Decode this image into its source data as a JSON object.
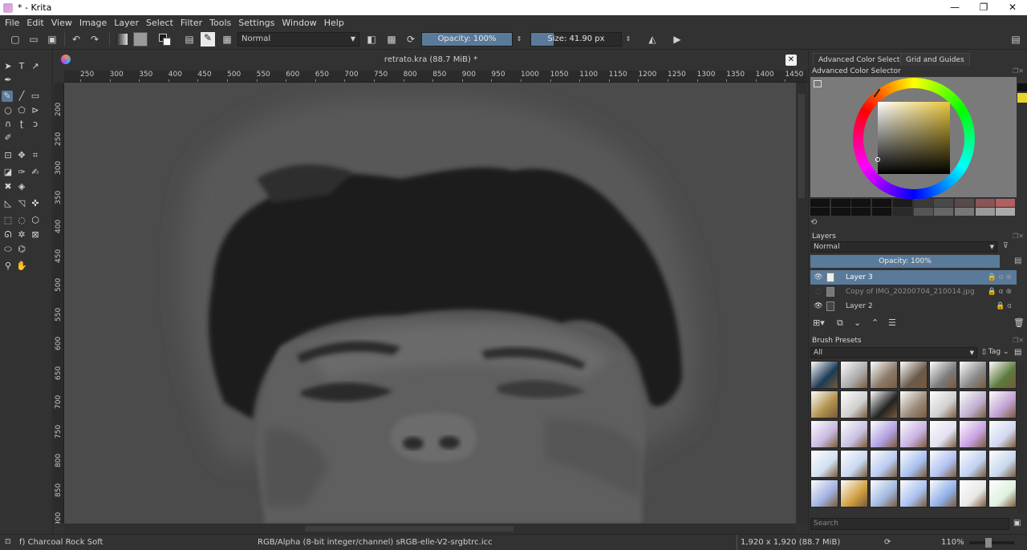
{
  "window": {
    "title": "* - Krita",
    "controls": [
      "—",
      "❐",
      "✕"
    ]
  },
  "menu": [
    "File",
    "Edit",
    "View",
    "Image",
    "Layer",
    "Select",
    "Filter",
    "Tools",
    "Settings",
    "Window",
    "Help"
  ],
  "toolbar": {
    "blend_mode": "Normal",
    "opacity_label": "Opacity: 100%",
    "opacity_value": 1.0,
    "size_label": "Size: 41.90 px",
    "size_fill": 0.25
  },
  "document": {
    "tab_title": "retrato.kra (88.7 MiB) *",
    "h_ruler": [
      "250",
      "300",
      "350",
      "400",
      "450",
      "500",
      "550",
      "600",
      "650",
      "700",
      "750",
      "800",
      "850",
      "900",
      "950",
      "1000",
      "1050",
      "1100",
      "1150",
      "1200",
      "1250",
      "1300",
      "1350",
      "1400",
      "1450"
    ],
    "v_ruler": [
      "200",
      "250",
      "300",
      "350",
      "400",
      "450",
      "500",
      "550",
      "600",
      "650",
      "700",
      "750",
      "800",
      "850",
      "900"
    ]
  },
  "panels": {
    "tabs": [
      "Advanced Color Selector",
      "Grid and Guides"
    ],
    "color_selector_title": "Advanced Color Selector",
    "selected_color": "#e8c63a",
    "layers": {
      "title": "Layers",
      "blend_mode": "Normal",
      "opacity_label": "Opacity:  100%",
      "items": [
        {
          "name": "Layer 3",
          "visible": true,
          "selected": true
        },
        {
          "name": "Copy of IMG_20200704_210014.jpg",
          "visible": false,
          "selected": false
        },
        {
          "name": "Layer 2",
          "visible": true,
          "selected": false
        }
      ]
    },
    "brush_presets": {
      "title": "Brush Presets",
      "filter": "All",
      "tag_label": "Tag",
      "search_placeholder": "Search"
    }
  },
  "status": {
    "brush_name": "f) Charcoal Rock Soft",
    "color_space": "RGB/Alpha (8-bit integer/channel)  sRGB-elle-V2-srgbtrc.icc",
    "image_size": "1,920 x 1,920 (88.7 MiB)",
    "zoom": "110%"
  },
  "colors": {
    "accent": "#5a7a9a",
    "background": "#323232",
    "canvas": "#4b4b4b"
  }
}
